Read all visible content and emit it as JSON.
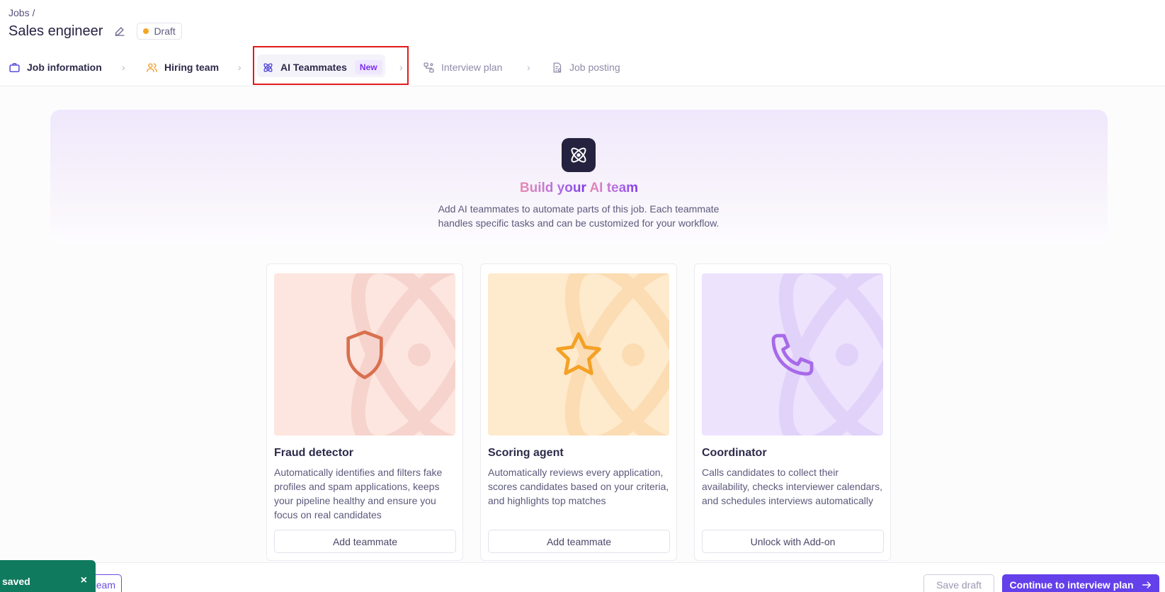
{
  "breadcrumb": "Jobs /",
  "job_title": "Sales engineer",
  "status": "Draft",
  "colors": {
    "accent": "#6440ea",
    "status_dot": "#f5a524",
    "toast": "#0f7a5d"
  },
  "steps": [
    {
      "label": "Job information",
      "icon": "briefcase-icon"
    },
    {
      "label": "Hiring team",
      "icon": "users-icon"
    },
    {
      "label": "AI Teammates",
      "icon": "atom-icon",
      "badge": "New"
    },
    {
      "label": "Interview plan",
      "icon": "workflow-icon"
    },
    {
      "label": "Job posting",
      "icon": "document-icon"
    }
  ],
  "hero": {
    "icon": "atom-icon",
    "title_prefix": "Build your",
    "title_highlight": "AI team",
    "description": "Add AI teammates to automate parts of this job. Each teammate handles specific tasks and can be customized for your workflow."
  },
  "cards": [
    {
      "title": "Fraud detector",
      "description": "Automatically identifies and filters fake profiles and spam applications, keeps your pipeline healthy and ensure you focus on real candidates",
      "button": "Add teammate",
      "icon": "shield-icon"
    },
    {
      "title": "Scoring agent",
      "description": "Automatically reviews every application, scores candidates based on your criteria, and highlights top matches",
      "button": "Add teammate",
      "icon": "star-icon"
    },
    {
      "title": "Coordinator",
      "description": "Calls candidates to collect their availability, checks interviewer calendars, and schedules interviews automatically",
      "button": "Unlock with Add-on",
      "icon": "phone-icon"
    }
  ],
  "footer": {
    "back_label": "eam",
    "save_draft": "Save draft",
    "continue": "Continue to interview plan"
  },
  "toast": {
    "text": "saved",
    "close": "×"
  }
}
